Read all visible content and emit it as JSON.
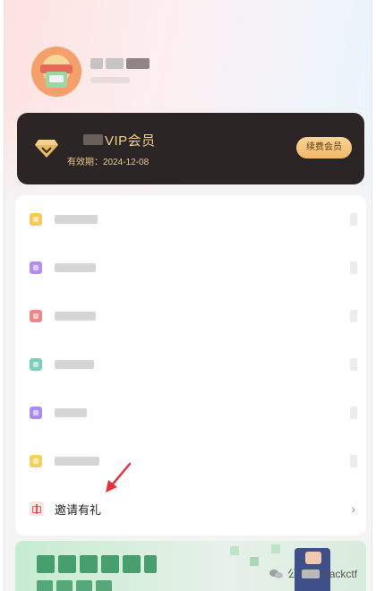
{
  "profile": {
    "avatar_icon": "avatar-icon"
  },
  "vip_card": {
    "title": "VIP会员",
    "expiry": "有效期：2024-12-08",
    "renew_label": "续费会员",
    "diamond_icon": "vip-diamond-icon",
    "accent_color": "#f3cf8e",
    "background_color": "#2b2625"
  },
  "menu": {
    "items": [
      {
        "icon": "menu-item-icon",
        "color": "#f8c95a",
        "label": ""
      },
      {
        "icon": "menu-item-icon",
        "color": "#b38cf2",
        "label": ""
      },
      {
        "icon": "menu-item-icon",
        "color": "#f1868a",
        "label": ""
      },
      {
        "icon": "menu-item-icon",
        "color": "#7dcfb5",
        "label": ""
      },
      {
        "icon": "menu-item-icon",
        "color": "#a98cf2",
        "label": ""
      },
      {
        "icon": "menu-item-icon",
        "color": "#f6d05a",
        "label": ""
      }
    ],
    "invite": {
      "label": "邀请有礼",
      "icon": "gift-icon",
      "chevron": "›"
    }
  },
  "annotation": {
    "color": "#e0333a",
    "icon": "red-arrow-annotation"
  },
  "watermark": {
    "prefix": "公",
    "name": "hackctf",
    "icon": "wechat-icon"
  }
}
